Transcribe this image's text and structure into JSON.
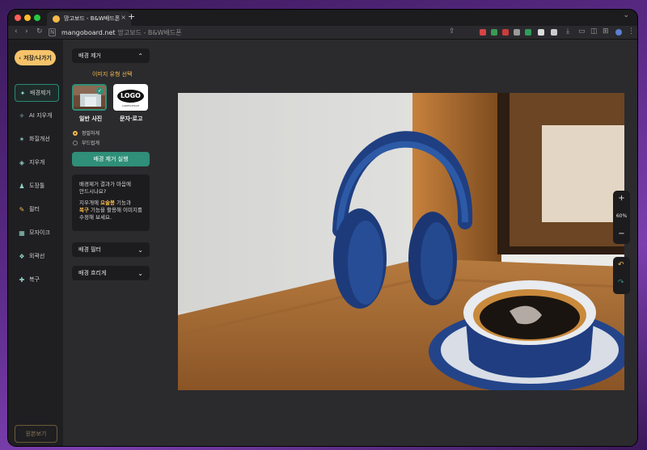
{
  "browser": {
    "tab_title": "망고보드 - B&W배드폰",
    "tab_close": "×",
    "new_tab": "+",
    "url_host": "mangoboard.net",
    "url_rest": "망고보드 - B&W배드폰"
  },
  "rail": {
    "back_label": "저장/나가기",
    "items": [
      {
        "label": "배경제거",
        "icon": "background-remove-icon"
      },
      {
        "label": "AI 지우개",
        "icon": "ai-eraser-icon"
      },
      {
        "label": "화질개선",
        "icon": "quality-icon"
      },
      {
        "label": "지우개",
        "icon": "eraser-icon"
      },
      {
        "label": "도장툴",
        "icon": "stamp-icon"
      },
      {
        "label": "필터",
        "icon": "filter-icon"
      },
      {
        "label": "모자이크",
        "icon": "mosaic-icon"
      },
      {
        "label": "외곽선",
        "icon": "outline-icon"
      },
      {
        "label": "복구",
        "icon": "restore-icon"
      }
    ],
    "original_label": "원본보기"
  },
  "panel": {
    "bg_remove_title": "배경 제거",
    "type_select_label": "이미지 유형 선택",
    "type_photo": "일반 사진",
    "type_logo": "문자·로고",
    "logo_text": "LOGO",
    "logo_sub": "LOREM IPSUM",
    "radio_precise": "정밀하게",
    "radio_soft": "부드럽게",
    "run_label": "배경 제거 실행",
    "info_line1": "배경제거 결과가 마음에",
    "info_line2": "안드시나요?",
    "info_line3a": "지우개에 ",
    "info_line3b": "요술봉",
    "info_line3c": " 기능과",
    "info_line4a": "복구",
    "info_line4b": " 기능을 활용해 이미지를",
    "info_line5": "수정해 보세요.",
    "filter_label": "배경 필터",
    "blur_label": "배경 흐리게"
  },
  "zoom": {
    "plus": "+",
    "level": "60%",
    "minus": "−"
  },
  "colors": {
    "accent_yellow": "#f2b84b",
    "accent_teal": "#2f8f78",
    "panel_bg": "#1c1c1f",
    "workspace_bg": "#2b2b2e"
  }
}
